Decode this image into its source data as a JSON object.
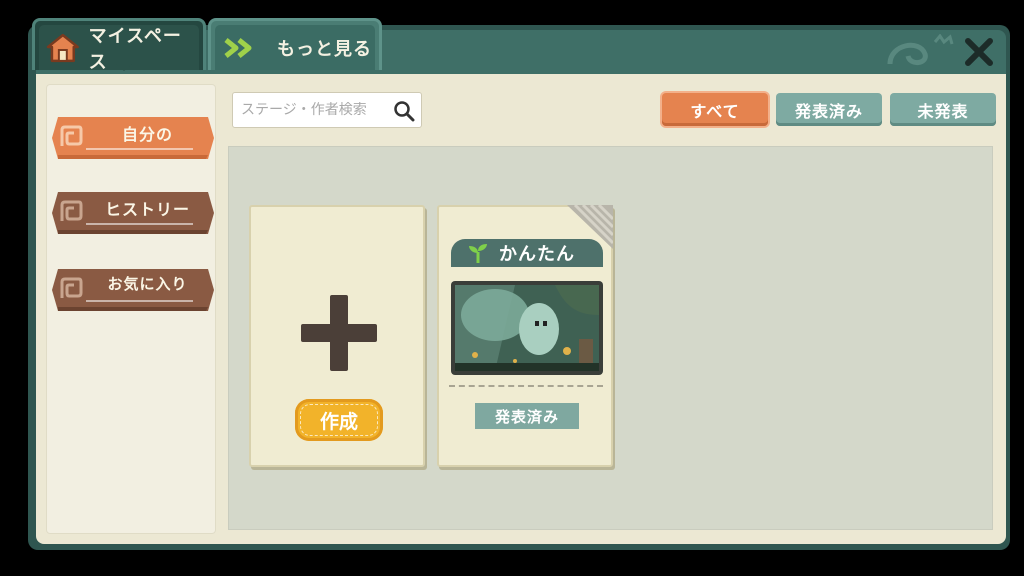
{
  "tabs": [
    {
      "label": "マイスペース",
      "icon": "home-icon",
      "active": true
    },
    {
      "label": "もっと見る",
      "icon": "double-chevron-right-icon",
      "active": false
    }
  ],
  "sidebar": {
    "items": [
      {
        "label": "自分の",
        "color": "#e5834f",
        "active": true
      },
      {
        "label": "ヒストリー",
        "color": "#8a5a43",
        "active": false
      },
      {
        "label": "お気に入り",
        "color": "#8a5a43",
        "active": false
      }
    ]
  },
  "search": {
    "placeholder": "ステージ・作者検索",
    "value": ""
  },
  "filters": [
    {
      "label": "すべて",
      "active": true
    },
    {
      "label": "発表済み",
      "active": false
    },
    {
      "label": "未発表",
      "active": false
    }
  ],
  "create_card": {
    "label": "作成"
  },
  "stages": [
    {
      "difficulty": "かんたん",
      "status": "発表済み"
    }
  ],
  "colors": {
    "accent_orange": "#e5834f",
    "teal": "#4e716b",
    "filter_inactive": "#7eaaa2",
    "create_yellow": "#f2b32a",
    "sidebar_brown": "#8a5a43"
  }
}
